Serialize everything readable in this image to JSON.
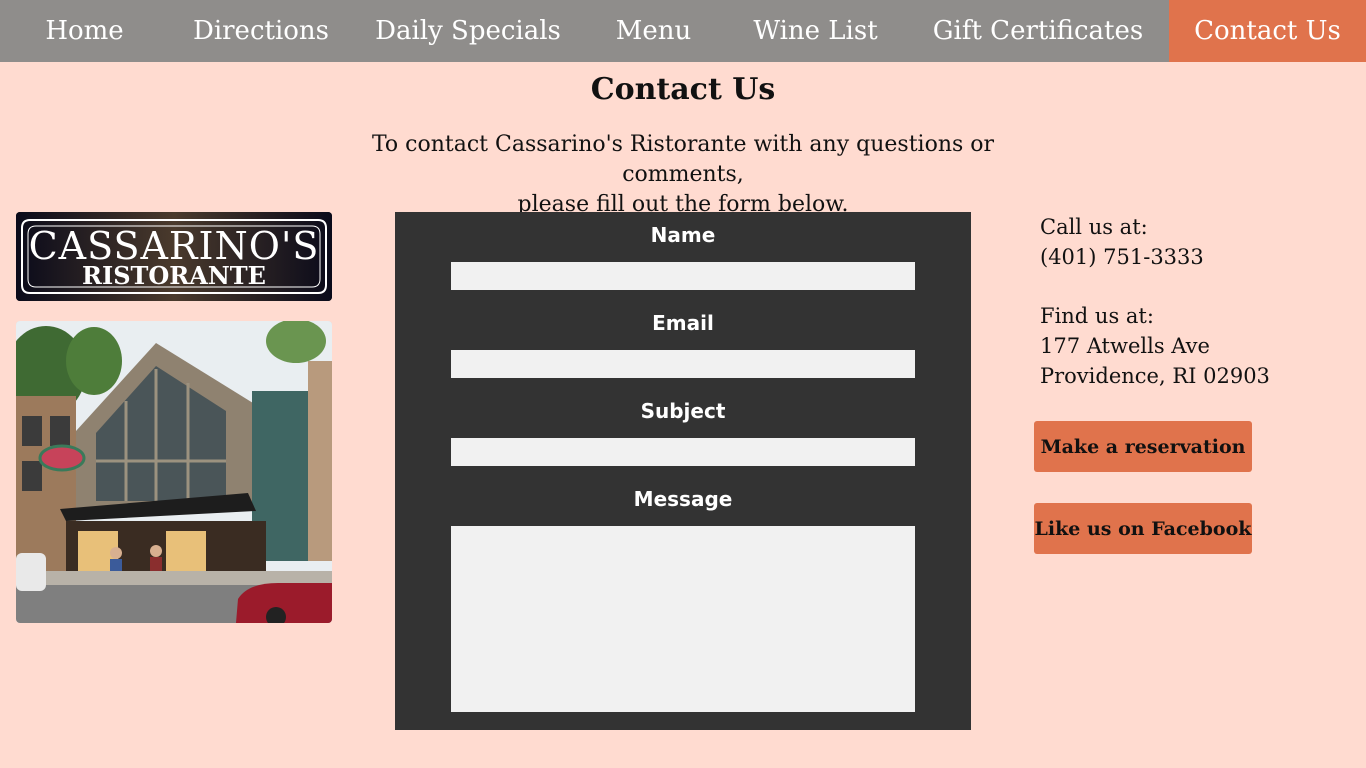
{
  "nav": {
    "items": [
      {
        "label": "Home"
      },
      {
        "label": "Directions"
      },
      {
        "label": "Daily Specials"
      },
      {
        "label": "Menu"
      },
      {
        "label": "Wine List"
      },
      {
        "label": "Gift Certificates"
      },
      {
        "label": "Contact Us",
        "active": true
      }
    ]
  },
  "page": {
    "title": "Contact Us",
    "intro_line1": "To contact Cassarino's Ristorante with any questions or comments,",
    "intro_line2": "please fill out the form below."
  },
  "logo": {
    "line1": "CASSARINO'S",
    "line2": "RISTORANTE"
  },
  "form": {
    "name_label": "Name",
    "email_label": "Email",
    "subject_label": "Subject",
    "message_label": "Message",
    "name_value": "",
    "email_value": "",
    "subject_value": "",
    "message_value": ""
  },
  "contact": {
    "call_label": "Call us at:",
    "phone": "(401) 751-3333",
    "find_label": "Find us at:",
    "address_line1": "177 Atwells Ave",
    "address_line2": "Providence, RI 02903"
  },
  "buttons": {
    "reservation": "Make a reservation",
    "facebook": "Like us on Facebook"
  },
  "colors": {
    "background": "#ffdbd0",
    "nav": "#8f8d8b",
    "accent": "#e0734c",
    "form_bg": "#333333",
    "input_bg": "#f1f1f1"
  }
}
